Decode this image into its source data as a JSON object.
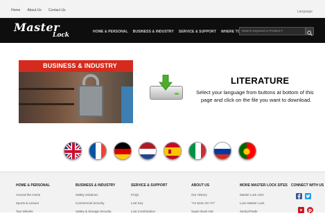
{
  "topbar": {
    "links": [
      "Home",
      "About Us",
      "Contact Us"
    ],
    "language_label": "Language"
  },
  "header": {
    "logo_main": "Master",
    "logo_sub": "Lock",
    "nav": [
      "HOME & PERSONAL",
      "BUSINESS & INDUSTRY",
      "SERVICE & SUPPORT",
      "WHERE TO BUY"
    ],
    "search_placeholder": "Search Keyword or Product #"
  },
  "hero": {
    "title": "BUSINESS & INDUSTRY"
  },
  "literature": {
    "title": "LITERATURE",
    "line1": "Select your language from buttons at bottom of this",
    "line2": "page and click on the file you want to download."
  },
  "flags": [
    {
      "name": "uk-flag"
    },
    {
      "name": "france-flag"
    },
    {
      "name": "germany-flag"
    },
    {
      "name": "netherlands-flag"
    },
    {
      "name": "spain-flag"
    },
    {
      "name": "italy-flag"
    },
    {
      "name": "russia-flag"
    },
    {
      "name": "portugal-flag"
    }
  ],
  "footer": {
    "columns": [
      {
        "heading": "HOME & PERSONAL",
        "items": [
          "Around the Home",
          "Sports & Leisure",
          "Two Wheels"
        ]
      },
      {
        "heading": "BUSINESS & INDUSTRY",
        "items": [
          "Safety Solutions",
          "Commercial Security",
          "Safety & Storage Security"
        ]
      },
      {
        "heading": "SERVICE & SUPPORT",
        "items": [
          "FAQs",
          "Lost Key",
          "Lost Combination"
        ]
      },
      {
        "heading": "ABOUT US",
        "items": [
          "Our History",
          "\"As Seen On TV\"",
          "Super Bowl Ads"
        ]
      },
      {
        "heading": "MORE MASTER LOCK SITES",
        "items": [
          "Master Lock USA",
          "Love Master Lock",
          "Sentry®Safe"
        ]
      },
      {
        "heading": "CONNECT WITH US",
        "items": []
      }
    ]
  },
  "colors": {
    "header_bg": "#0e0e0e",
    "hero_red": "#d52b1e",
    "facebook": "#3b5998",
    "twitter": "#1da1f2",
    "youtube": "#cc181e",
    "pinterest": "#cb2027"
  }
}
